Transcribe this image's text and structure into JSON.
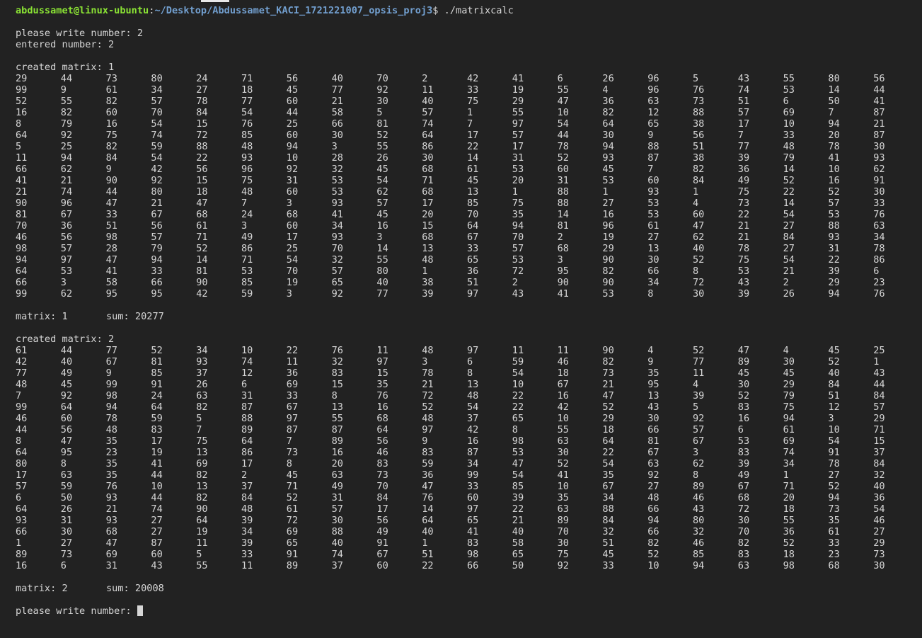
{
  "prompt": {
    "user_host": "abdussamet@linux-ubuntu",
    "separator": ":",
    "path": "~/Desktop/Abdussamet_KACI_1721221007_opsis_proj3",
    "symbol": "$",
    "command": " ./matrixcalc"
  },
  "input_prompt": "please write number: 2",
  "entered_line": "entered number: 2",
  "matrices": [
    {
      "header": "created matrix: 1",
      "rows": [
        [
          29,
          44,
          73,
          80,
          24,
          71,
          56,
          40,
          70,
          2,
          42,
          41,
          6,
          26,
          96,
          5,
          43,
          55,
          80,
          56
        ],
        [
          99,
          9,
          61,
          34,
          27,
          18,
          45,
          77,
          92,
          11,
          33,
          19,
          55,
          4,
          96,
          76,
          74,
          53,
          14,
          44
        ],
        [
          52,
          55,
          82,
          57,
          78,
          77,
          60,
          21,
          30,
          40,
          75,
          29,
          47,
          36,
          63,
          73,
          51,
          6,
          50,
          41
        ],
        [
          16,
          82,
          60,
          70,
          84,
          54,
          44,
          58,
          5,
          57,
          1,
          55,
          10,
          82,
          12,
          88,
          57,
          69,
          7,
          87
        ],
        [
          8,
          79,
          16,
          54,
          15,
          76,
          25,
          66,
          81,
          74,
          7,
          97,
          54,
          64,
          65,
          38,
          17,
          10,
          94,
          21
        ],
        [
          64,
          92,
          75,
          74,
          72,
          85,
          60,
          30,
          52,
          64,
          17,
          57,
          44,
          30,
          9,
          56,
          7,
          33,
          20,
          87
        ],
        [
          5,
          25,
          82,
          59,
          88,
          48,
          94,
          3,
          55,
          86,
          22,
          17,
          78,
          94,
          88,
          51,
          77,
          48,
          78,
          30
        ],
        [
          11,
          94,
          84,
          54,
          22,
          93,
          10,
          28,
          26,
          30,
          14,
          31,
          52,
          93,
          87,
          38,
          39,
          79,
          41,
          93
        ],
        [
          66,
          62,
          9,
          42,
          56,
          96,
          92,
          32,
          45,
          68,
          61,
          53,
          60,
          45,
          7,
          82,
          36,
          14,
          10,
          62
        ],
        [
          41,
          21,
          90,
          92,
          15,
          75,
          31,
          53,
          54,
          71,
          45,
          20,
          31,
          53,
          60,
          84,
          49,
          52,
          16,
          91
        ],
        [
          21,
          74,
          44,
          80,
          18,
          48,
          60,
          53,
          62,
          68,
          13,
          1,
          88,
          1,
          93,
          1,
          75,
          22,
          52,
          30
        ],
        [
          90,
          96,
          47,
          21,
          47,
          7,
          3,
          93,
          57,
          17,
          85,
          75,
          88,
          27,
          53,
          4,
          73,
          14,
          57,
          33
        ],
        [
          81,
          67,
          33,
          67,
          68,
          24,
          68,
          41,
          45,
          20,
          70,
          35,
          14,
          16,
          53,
          60,
          22,
          54,
          53,
          76
        ],
        [
          70,
          36,
          51,
          56,
          61,
          3,
          60,
          34,
          16,
          15,
          64,
          94,
          81,
          96,
          61,
          47,
          21,
          27,
          88,
          63
        ],
        [
          46,
          56,
          98,
          57,
          71,
          49,
          17,
          93,
          3,
          68,
          67,
          70,
          2,
          19,
          27,
          62,
          21,
          84,
          93,
          34
        ],
        [
          98,
          57,
          28,
          79,
          52,
          86,
          25,
          70,
          14,
          13,
          33,
          57,
          68,
          29,
          13,
          40,
          78,
          27,
          31,
          78
        ],
        [
          94,
          97,
          47,
          94,
          14,
          71,
          54,
          32,
          55,
          48,
          65,
          53,
          3,
          90,
          30,
          52,
          75,
          54,
          22,
          86
        ],
        [
          64,
          53,
          41,
          33,
          81,
          53,
          70,
          57,
          80,
          1,
          36,
          72,
          95,
          82,
          66,
          8,
          53,
          21,
          39,
          6
        ],
        [
          66,
          3,
          58,
          66,
          90,
          85,
          19,
          65,
          40,
          38,
          51,
          2,
          90,
          90,
          34,
          72,
          43,
          2,
          29,
          23
        ],
        [
          99,
          62,
          95,
          95,
          42,
          59,
          3,
          92,
          77,
          39,
          97,
          43,
          41,
          53,
          8,
          30,
          39,
          26,
          94,
          76
        ]
      ],
      "status_label": "matrix: 1",
      "sum_label": "sum: 20277"
    },
    {
      "header": "created matrix: 2",
      "rows": [
        [
          61,
          44,
          77,
          52,
          34,
          10,
          22,
          76,
          11,
          48,
          97,
          11,
          11,
          90,
          4,
          52,
          47,
          4,
          45,
          25
        ],
        [
          42,
          40,
          67,
          81,
          93,
          74,
          11,
          32,
          97,
          3,
          6,
          59,
          46,
          82,
          9,
          77,
          89,
          30,
          52,
          1
        ],
        [
          77,
          49,
          9,
          85,
          37,
          12,
          36,
          83,
          15,
          78,
          8,
          54,
          18,
          73,
          35,
          11,
          45,
          45,
          40,
          43
        ],
        [
          48,
          45,
          99,
          91,
          26,
          6,
          69,
          15,
          35,
          21,
          13,
          10,
          67,
          21,
          95,
          4,
          30,
          29,
          84,
          44
        ],
        [
          7,
          92,
          98,
          24,
          63,
          31,
          33,
          8,
          76,
          72,
          48,
          22,
          16,
          47,
          13,
          39,
          52,
          79,
          51,
          84
        ],
        [
          99,
          64,
          94,
          64,
          82,
          87,
          67,
          13,
          16,
          52,
          54,
          22,
          42,
          52,
          43,
          5,
          83,
          75,
          12,
          57
        ],
        [
          46,
          60,
          78,
          59,
          5,
          88,
          97,
          55,
          68,
          48,
          37,
          65,
          10,
          29,
          30,
          92,
          16,
          94,
          3,
          29
        ],
        [
          44,
          56,
          48,
          83,
          7,
          89,
          87,
          87,
          64,
          97,
          42,
          8,
          55,
          18,
          66,
          57,
          6,
          61,
          10,
          71
        ],
        [
          8,
          47,
          35,
          17,
          75,
          64,
          7,
          89,
          56,
          9,
          16,
          98,
          63,
          64,
          81,
          67,
          53,
          69,
          54,
          15
        ],
        [
          64,
          95,
          23,
          19,
          13,
          86,
          73,
          16,
          46,
          83,
          87,
          53,
          30,
          22,
          67,
          3,
          83,
          74,
          91,
          37
        ],
        [
          80,
          8,
          35,
          41,
          69,
          17,
          8,
          20,
          83,
          59,
          34,
          47,
          52,
          54,
          63,
          62,
          39,
          34,
          78,
          84
        ],
        [
          17,
          63,
          35,
          44,
          82,
          2,
          45,
          63,
          73,
          36,
          99,
          54,
          41,
          35,
          92,
          8,
          49,
          1,
          27,
          32
        ],
        [
          57,
          59,
          76,
          10,
          13,
          37,
          71,
          49,
          70,
          47,
          33,
          85,
          10,
          67,
          27,
          89,
          67,
          71,
          52,
          40
        ],
        [
          6,
          50,
          93,
          44,
          82,
          84,
          52,
          31,
          84,
          76,
          60,
          39,
          35,
          34,
          48,
          46,
          68,
          20,
          94,
          36
        ],
        [
          64,
          26,
          21,
          74,
          90,
          48,
          61,
          57,
          17,
          14,
          97,
          22,
          63,
          88,
          66,
          43,
          72,
          18,
          73,
          54
        ],
        [
          93,
          31,
          93,
          27,
          64,
          39,
          72,
          30,
          56,
          64,
          65,
          21,
          89,
          84,
          94,
          80,
          30,
          55,
          35,
          46
        ],
        [
          66,
          30,
          68,
          27,
          19,
          34,
          69,
          88,
          49,
          40,
          41,
          40,
          70,
          32,
          66,
          32,
          70,
          36,
          61,
          27
        ],
        [
          1,
          27,
          47,
          87,
          11,
          39,
          65,
          40,
          91,
          1,
          83,
          58,
          30,
          51,
          82,
          46,
          82,
          52,
          33,
          29
        ],
        [
          89,
          73,
          69,
          60,
          5,
          33,
          91,
          74,
          67,
          51,
          98,
          65,
          75,
          45,
          52,
          85,
          83,
          18,
          23,
          73
        ],
        [
          16,
          6,
          31,
          43,
          55,
          11,
          89,
          37,
          60,
          22,
          66,
          50,
          92,
          33,
          10,
          94,
          63,
          98,
          68,
          30
        ]
      ],
      "status_label": "matrix: 2",
      "sum_label": "sum: 20008"
    }
  ],
  "final_prompt": "please write number: "
}
